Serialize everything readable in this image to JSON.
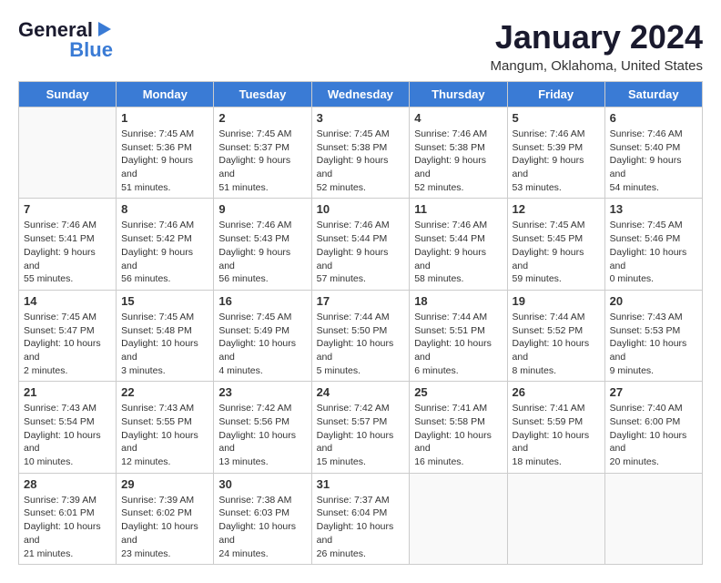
{
  "header": {
    "logo_line1": "General",
    "logo_line2": "Blue",
    "month_title": "January 2024",
    "location": "Mangum, Oklahoma, United States"
  },
  "days_of_week": [
    "Sunday",
    "Monday",
    "Tuesday",
    "Wednesday",
    "Thursday",
    "Friday",
    "Saturday"
  ],
  "weeks": [
    [
      {
        "day": "",
        "empty": true
      },
      {
        "day": "1",
        "sunrise": "Sunrise: 7:45 AM",
        "sunset": "Sunset: 5:36 PM",
        "daylight": "Daylight: 9 hours and 51 minutes."
      },
      {
        "day": "2",
        "sunrise": "Sunrise: 7:45 AM",
        "sunset": "Sunset: 5:37 PM",
        "daylight": "Daylight: 9 hours and 51 minutes."
      },
      {
        "day": "3",
        "sunrise": "Sunrise: 7:45 AM",
        "sunset": "Sunset: 5:38 PM",
        "daylight": "Daylight: 9 hours and 52 minutes."
      },
      {
        "day": "4",
        "sunrise": "Sunrise: 7:46 AM",
        "sunset": "Sunset: 5:38 PM",
        "daylight": "Daylight: 9 hours and 52 minutes."
      },
      {
        "day": "5",
        "sunrise": "Sunrise: 7:46 AM",
        "sunset": "Sunset: 5:39 PM",
        "daylight": "Daylight: 9 hours and 53 minutes."
      },
      {
        "day": "6",
        "sunrise": "Sunrise: 7:46 AM",
        "sunset": "Sunset: 5:40 PM",
        "daylight": "Daylight: 9 hours and 54 minutes."
      }
    ],
    [
      {
        "day": "7",
        "sunrise": "Sunrise: 7:46 AM",
        "sunset": "Sunset: 5:41 PM",
        "daylight": "Daylight: 9 hours and 55 minutes."
      },
      {
        "day": "8",
        "sunrise": "Sunrise: 7:46 AM",
        "sunset": "Sunset: 5:42 PM",
        "daylight": "Daylight: 9 hours and 56 minutes."
      },
      {
        "day": "9",
        "sunrise": "Sunrise: 7:46 AM",
        "sunset": "Sunset: 5:43 PM",
        "daylight": "Daylight: 9 hours and 56 minutes."
      },
      {
        "day": "10",
        "sunrise": "Sunrise: 7:46 AM",
        "sunset": "Sunset: 5:44 PM",
        "daylight": "Daylight: 9 hours and 57 minutes."
      },
      {
        "day": "11",
        "sunrise": "Sunrise: 7:46 AM",
        "sunset": "Sunset: 5:44 PM",
        "daylight": "Daylight: 9 hours and 58 minutes."
      },
      {
        "day": "12",
        "sunrise": "Sunrise: 7:45 AM",
        "sunset": "Sunset: 5:45 PM",
        "daylight": "Daylight: 9 hours and 59 minutes."
      },
      {
        "day": "13",
        "sunrise": "Sunrise: 7:45 AM",
        "sunset": "Sunset: 5:46 PM",
        "daylight": "Daylight: 10 hours and 0 minutes."
      }
    ],
    [
      {
        "day": "14",
        "sunrise": "Sunrise: 7:45 AM",
        "sunset": "Sunset: 5:47 PM",
        "daylight": "Daylight: 10 hours and 2 minutes."
      },
      {
        "day": "15",
        "sunrise": "Sunrise: 7:45 AM",
        "sunset": "Sunset: 5:48 PM",
        "daylight": "Daylight: 10 hours and 3 minutes."
      },
      {
        "day": "16",
        "sunrise": "Sunrise: 7:45 AM",
        "sunset": "Sunset: 5:49 PM",
        "daylight": "Daylight: 10 hours and 4 minutes."
      },
      {
        "day": "17",
        "sunrise": "Sunrise: 7:44 AM",
        "sunset": "Sunset: 5:50 PM",
        "daylight": "Daylight: 10 hours and 5 minutes."
      },
      {
        "day": "18",
        "sunrise": "Sunrise: 7:44 AM",
        "sunset": "Sunset: 5:51 PM",
        "daylight": "Daylight: 10 hours and 6 minutes."
      },
      {
        "day": "19",
        "sunrise": "Sunrise: 7:44 AM",
        "sunset": "Sunset: 5:52 PM",
        "daylight": "Daylight: 10 hours and 8 minutes."
      },
      {
        "day": "20",
        "sunrise": "Sunrise: 7:43 AM",
        "sunset": "Sunset: 5:53 PM",
        "daylight": "Daylight: 10 hours and 9 minutes."
      }
    ],
    [
      {
        "day": "21",
        "sunrise": "Sunrise: 7:43 AM",
        "sunset": "Sunset: 5:54 PM",
        "daylight": "Daylight: 10 hours and 10 minutes."
      },
      {
        "day": "22",
        "sunrise": "Sunrise: 7:43 AM",
        "sunset": "Sunset: 5:55 PM",
        "daylight": "Daylight: 10 hours and 12 minutes."
      },
      {
        "day": "23",
        "sunrise": "Sunrise: 7:42 AM",
        "sunset": "Sunset: 5:56 PM",
        "daylight": "Daylight: 10 hours and 13 minutes."
      },
      {
        "day": "24",
        "sunrise": "Sunrise: 7:42 AM",
        "sunset": "Sunset: 5:57 PM",
        "daylight": "Daylight: 10 hours and 15 minutes."
      },
      {
        "day": "25",
        "sunrise": "Sunrise: 7:41 AM",
        "sunset": "Sunset: 5:58 PM",
        "daylight": "Daylight: 10 hours and 16 minutes."
      },
      {
        "day": "26",
        "sunrise": "Sunrise: 7:41 AM",
        "sunset": "Sunset: 5:59 PM",
        "daylight": "Daylight: 10 hours and 18 minutes."
      },
      {
        "day": "27",
        "sunrise": "Sunrise: 7:40 AM",
        "sunset": "Sunset: 6:00 PM",
        "daylight": "Daylight: 10 hours and 20 minutes."
      }
    ],
    [
      {
        "day": "28",
        "sunrise": "Sunrise: 7:39 AM",
        "sunset": "Sunset: 6:01 PM",
        "daylight": "Daylight: 10 hours and 21 minutes."
      },
      {
        "day": "29",
        "sunrise": "Sunrise: 7:39 AM",
        "sunset": "Sunset: 6:02 PM",
        "daylight": "Daylight: 10 hours and 23 minutes."
      },
      {
        "day": "30",
        "sunrise": "Sunrise: 7:38 AM",
        "sunset": "Sunset: 6:03 PM",
        "daylight": "Daylight: 10 hours and 24 minutes."
      },
      {
        "day": "31",
        "sunrise": "Sunrise: 7:37 AM",
        "sunset": "Sunset: 6:04 PM",
        "daylight": "Daylight: 10 hours and 26 minutes."
      },
      {
        "day": "",
        "empty": true
      },
      {
        "day": "",
        "empty": true
      },
      {
        "day": "",
        "empty": true
      }
    ]
  ]
}
